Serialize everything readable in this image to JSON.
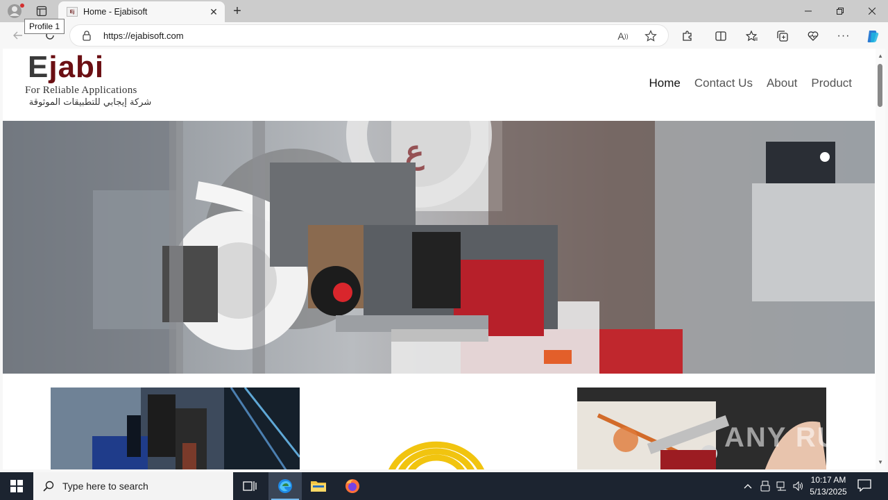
{
  "browser": {
    "tab_title": "Home - Ejabisoft",
    "tooltip": "Profile 1",
    "url": "https://ejabisoft.com"
  },
  "site": {
    "logo_wordmark_e": "E",
    "logo_wordmark_rest": "jabi",
    "logo_tagline": "For Reliable Applications",
    "logo_arabic": "شركة إيجابي للتطبيقات الموثوقة",
    "nav": [
      "Home",
      "Contact Us",
      "About",
      "Product"
    ],
    "active_nav": "Home"
  },
  "watermark": "ANY RUN",
  "taskbar": {
    "search_placeholder": "Type here to search",
    "time": "10:17 AM",
    "date": "5/13/2025"
  },
  "colors": {
    "brand": "#6b0f13",
    "taskbar": "#1c2430",
    "chrome": "#cccccc"
  }
}
